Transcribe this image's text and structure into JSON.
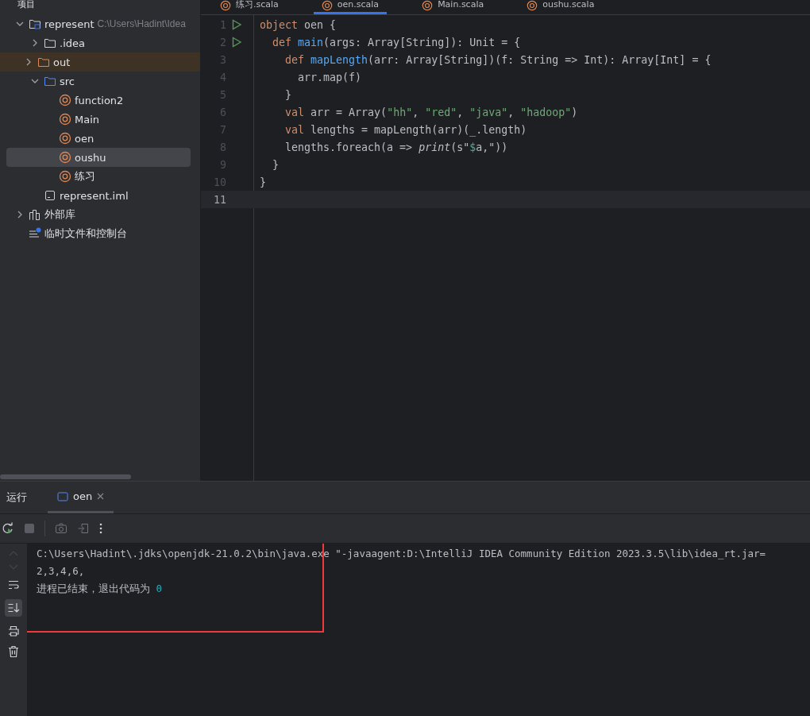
{
  "project_header": "项目",
  "tree": [
    {
      "label": "represent",
      "path": "C:\\Users\\Hadint\\Idea",
      "kind": "module",
      "expanded": true,
      "selected": false,
      "children": [
        {
          "label": ".idea",
          "kind": "folder",
          "expanded": false,
          "selected": false
        },
        {
          "label": "out",
          "kind": "excluded",
          "expanded": false,
          "selected": false
        },
        {
          "label": "src",
          "kind": "source",
          "expanded": true,
          "selected": false,
          "children": [
            {
              "label": "function2",
              "kind": "scala",
              "selected": false
            },
            {
              "label": "Main",
              "kind": "scala",
              "selected": false
            },
            {
              "label": "oen",
              "kind": "scala",
              "selected": false
            },
            {
              "label": "oushu",
              "kind": "scala",
              "selected": true
            },
            {
              "label": "练习",
              "kind": "scala",
              "selected": false
            }
          ]
        },
        {
          "label": "represent.iml",
          "kind": "iml",
          "selected": false
        }
      ]
    },
    {
      "label": "外部库",
      "kind": "library",
      "expanded": false,
      "selected": false
    },
    {
      "label": "临时文件和控制台",
      "kind": "scratch",
      "selected": false
    }
  ],
  "editor_tabs": [
    {
      "label": "练习.scala",
      "selected": false
    },
    {
      "label": "oen.scala",
      "selected": true
    },
    {
      "label": "Main.scala",
      "selected": false
    },
    {
      "label": "oushu.scala",
      "selected": false
    }
  ],
  "code": [
    {
      "number": "1",
      "run": true,
      "current": false,
      "tokens": [
        {
          "t": "object",
          "kind": "keyword"
        },
        {
          "t": " oen {",
          "kind": "plain"
        }
      ]
    },
    {
      "number": "2",
      "run": true,
      "current": false,
      "tokens": [
        {
          "t": "  def",
          "kind": "keyword"
        },
        {
          "t": " main",
          "kind": "function"
        },
        {
          "t": "(args: Array[String]): Unit = {",
          "kind": "plain"
        }
      ]
    },
    {
      "number": "3",
      "run": false,
      "current": false,
      "tokens": [
        {
          "t": "    def",
          "kind": "keyword"
        },
        {
          "t": " mapLength",
          "kind": "function"
        },
        {
          "t": "(arr: Array[String])(f: String => Int): Array[Int] = {",
          "kind": "plain"
        }
      ]
    },
    {
      "number": "4",
      "run": false,
      "current": false,
      "tokens": [
        {
          "t": "      arr.map(f)",
          "kind": "plain"
        }
      ]
    },
    {
      "number": "5",
      "run": false,
      "current": false,
      "tokens": [
        {
          "t": "    }",
          "kind": "plain"
        }
      ]
    },
    {
      "number": "6",
      "run": false,
      "current": false,
      "tokens": [
        {
          "t": "    val",
          "kind": "keyword"
        },
        {
          "t": " arr = Array(",
          "kind": "plain"
        },
        {
          "t": "\"hh\"",
          "kind": "string"
        },
        {
          "t": ", ",
          "kind": "plain"
        },
        {
          "t": "\"red\"",
          "kind": "string"
        },
        {
          "t": ", ",
          "kind": "plain"
        },
        {
          "t": "\"java\"",
          "kind": "string"
        },
        {
          "t": ", ",
          "kind": "plain"
        },
        {
          "t": "\"hadoop\"",
          "kind": "string"
        },
        {
          "t": ")",
          "kind": "plain"
        }
      ]
    },
    {
      "number": "7",
      "run": false,
      "current": false,
      "tokens": [
        {
          "t": "    val",
          "kind": "keyword"
        },
        {
          "t": " lengths = mapLength(arr)(_.length)",
          "kind": "plain"
        }
      ]
    },
    {
      "number": "8",
      "run": false,
      "current": false,
      "tokens": [
        {
          "t": "    lengths.foreach(a => ",
          "kind": "plain"
        },
        {
          "t": "print",
          "kind": "italic"
        },
        {
          "t": "(s\"",
          "kind": "plain"
        },
        {
          "t": "$",
          "kind": "interpolation"
        },
        {
          "t": "a,\"",
          "kind": "plain"
        },
        {
          "t": "))",
          "kind": "plain"
        }
      ]
    },
    {
      "number": "9",
      "run": false,
      "current": false,
      "tokens": [
        {
          "t": "  }",
          "kind": "plain"
        }
      ]
    },
    {
      "number": "10",
      "run": false,
      "current": false,
      "tokens": [
        {
          "t": "}",
          "kind": "plain"
        }
      ]
    },
    {
      "number": "11",
      "run": false,
      "current": true
    }
  ],
  "run_panel": {
    "title": "运行",
    "tabs": [
      {
        "label": "oen",
        "selected": true
      }
    ],
    "console": [
      {
        "tokens": [
          {
            "t": "C:\\Users\\Hadint\\.jdks\\openjdk-21.0.2\\bin\\java.exe \"-javaagent:D:\\IntelliJ IDEA Community Edition 2023.3.5\\lib\\idea_rt.jar=",
            "kind": "plain"
          }
        ]
      },
      {
        "tokens": [
          {
            "t": "2,3,4,6,",
            "kind": "plain"
          }
        ]
      },
      {
        "tokens": [
          {
            "t": "进程已结束，退出代码为 ",
            "kind": "plain"
          },
          {
            "t": "0",
            "kind": "number"
          }
        ]
      }
    ],
    "scroll_to_end": true
  }
}
